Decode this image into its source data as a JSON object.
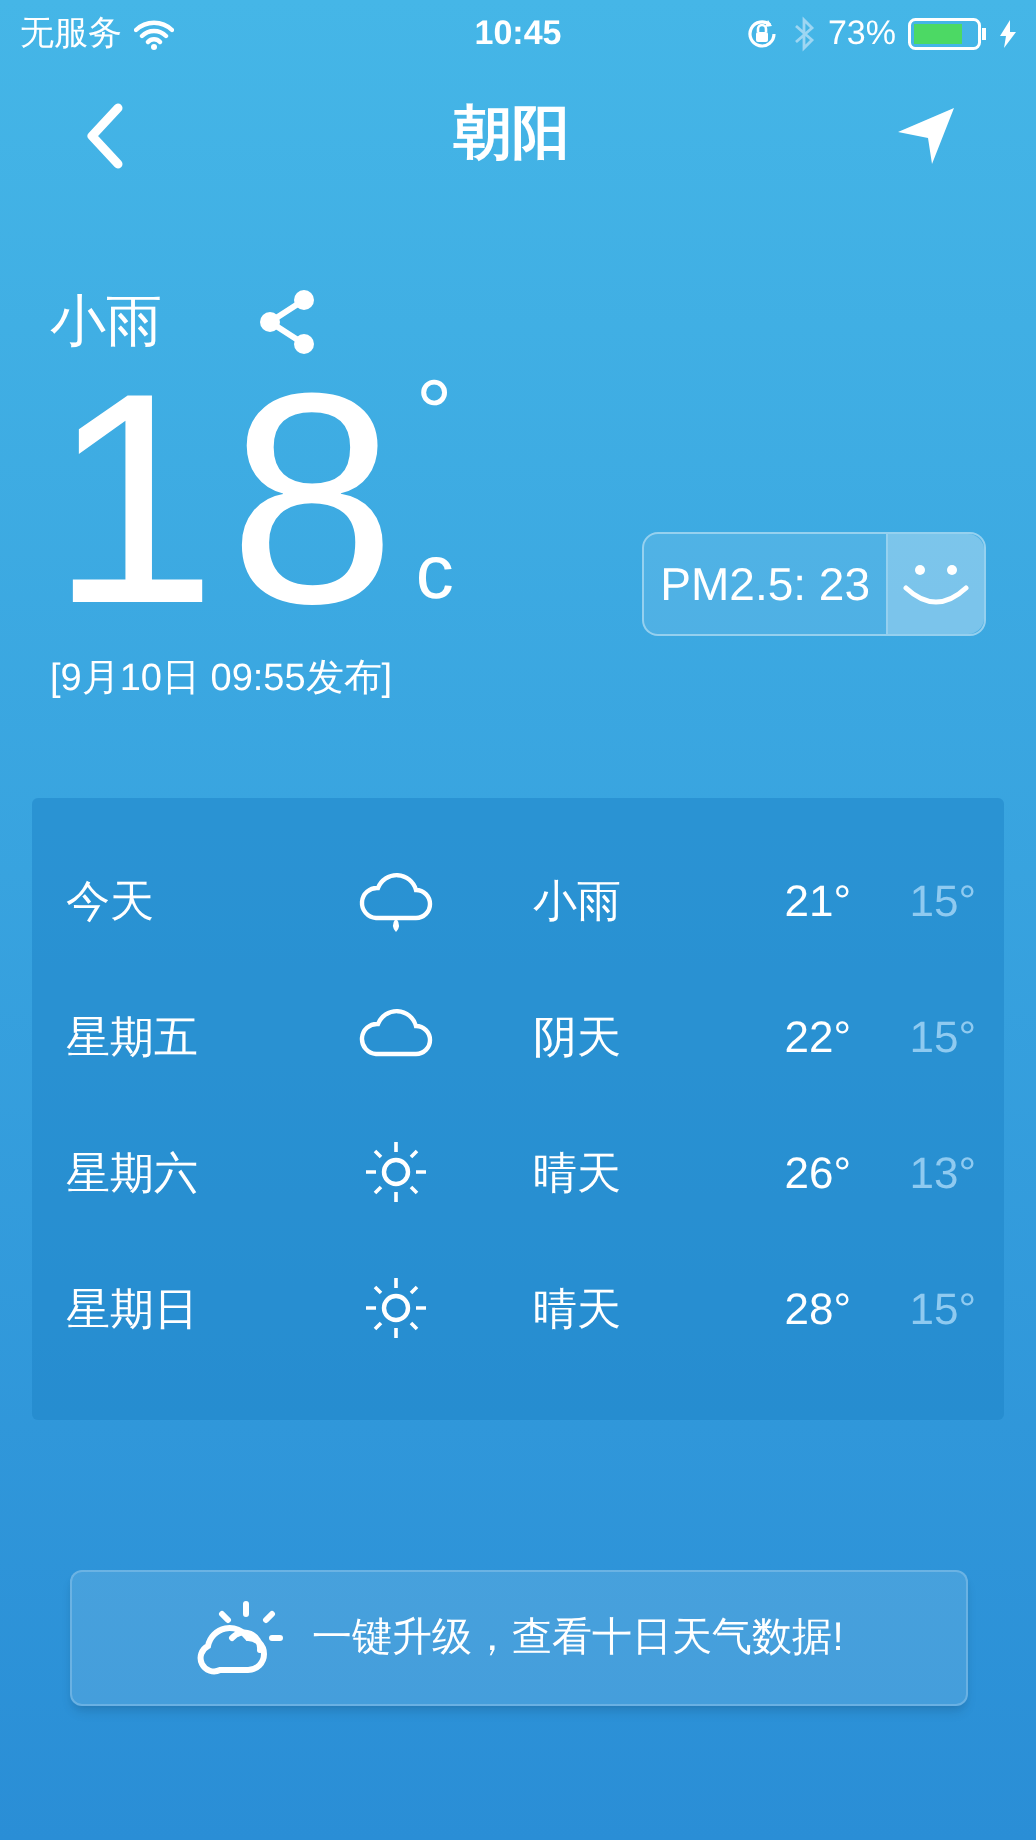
{
  "status_bar": {
    "carrier": "无服务",
    "time": "10:45",
    "battery": "73%"
  },
  "header": {
    "title": "朝阳"
  },
  "current": {
    "condition": "小雨",
    "temperature": "18",
    "degree": "°",
    "unit": "c",
    "published": "[9月10日 09:55发布]",
    "pm25": "PM2.5: 23"
  },
  "forecast": [
    {
      "day": "今天",
      "kind": "rain",
      "condition": "小雨",
      "high": "21°",
      "low": "15°"
    },
    {
      "day": "星期五",
      "kind": "cloudy",
      "condition": "阴天",
      "high": "22°",
      "low": "15°"
    },
    {
      "day": "星期六",
      "kind": "sunny",
      "condition": "晴天",
      "high": "26°",
      "low": "13°"
    },
    {
      "day": "星期日",
      "kind": "sunny",
      "condition": "晴天",
      "high": "28°",
      "low": "15°"
    }
  ],
  "upgrade_button": {
    "label": "一键升级，查看十日天气数据!"
  }
}
